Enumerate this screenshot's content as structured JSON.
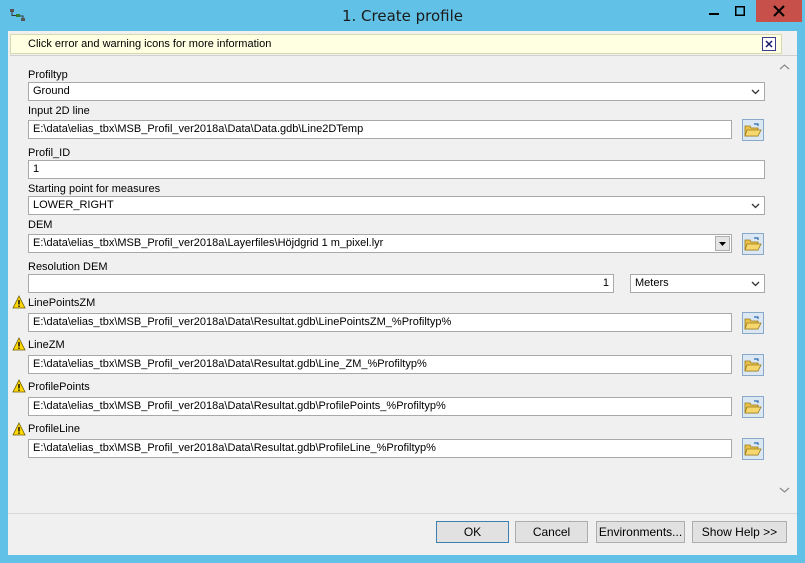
{
  "window": {
    "title": "1. Create profile",
    "icon": "toolbox-icon",
    "controls": {
      "minimize": "minimize-icon",
      "maximize": "maximize-icon",
      "close": "close-icon"
    }
  },
  "infobar": {
    "text": "Click error and warning icons for more information"
  },
  "fields": {
    "profiltyp": {
      "label": "Profiltyp",
      "value": "Ground"
    },
    "input_line": {
      "label": "Input 2D line",
      "value": "E:\\data\\elias_tbx\\MSB_Profil_ver2018a\\Data\\Data.gdb\\Line2DTemp"
    },
    "profil_id": {
      "label": "Profil_ID",
      "value": "1"
    },
    "starting_point": {
      "label": "Starting point for measures",
      "value": "LOWER_RIGHT"
    },
    "dem": {
      "label": "DEM",
      "value": "E:\\data\\elias_tbx\\MSB_Profil_ver2018a\\Layerfiles\\Höjdgrid 1 m_pixel.lyr"
    },
    "resolution": {
      "label": "Resolution DEM",
      "value": "1",
      "unit": "Meters"
    },
    "linepointszm": {
      "label": "LinePointsZM",
      "value": "E:\\data\\elias_tbx\\MSB_Profil_ver2018a\\Data\\Resultat.gdb\\LinePointsZM_%Profiltyp%"
    },
    "linezm": {
      "label": "LineZM",
      "value": "E:\\data\\elias_tbx\\MSB_Profil_ver2018a\\Data\\Resultat.gdb\\Line_ZM_%Profiltyp%"
    },
    "profilepoints": {
      "label": "ProfilePoints",
      "value": "E:\\data\\elias_tbx\\MSB_Profil_ver2018a\\Data\\Resultat.gdb\\ProfilePoints_%Profiltyp%"
    },
    "profileline": {
      "label": "ProfileLine",
      "value": "E:\\data\\elias_tbx\\MSB_Profil_ver2018a\\Data\\Resultat.gdb\\ProfileLine_%Profiltyp%"
    }
  },
  "buttons": {
    "ok": "OK",
    "cancel": "Cancel",
    "environments": "Environments...",
    "show_help": "Show Help >>"
  },
  "colors": {
    "titlebar": "#62c1e6",
    "infobar": "#ffffe1",
    "close": "#c7504b",
    "warning": "#ffd800"
  }
}
